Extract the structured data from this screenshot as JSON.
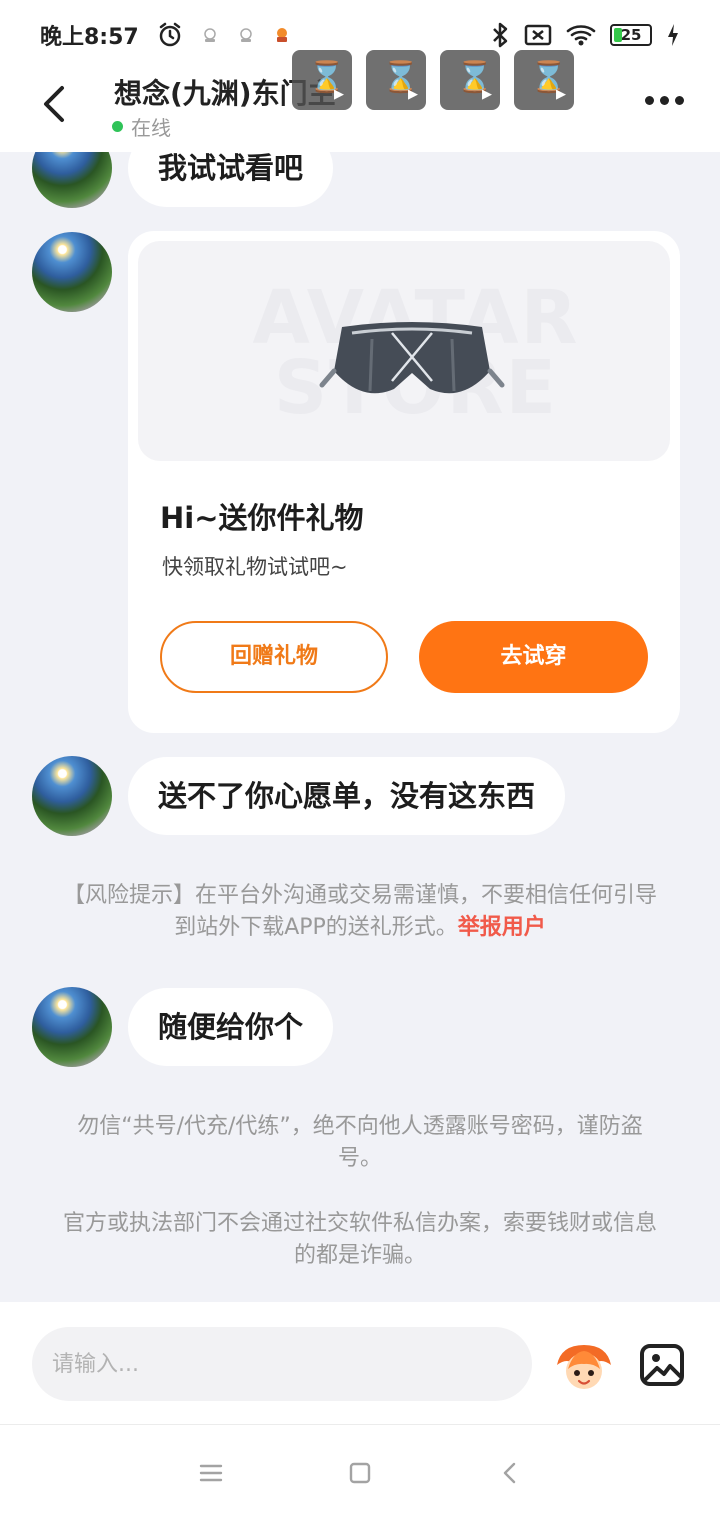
{
  "status_bar": {
    "time": "晚上8:57",
    "battery": "25"
  },
  "header": {
    "title": "想念(九渊)东门主",
    "status": "在线"
  },
  "messages": [
    {
      "text": "我试试看吧"
    },
    {
      "text": "送不了你心愿单，没有这东西"
    },
    {
      "text": "随便给你个"
    }
  ],
  "gift_card": {
    "watermark_line1": "AVATAR",
    "watermark_line2": "STORE",
    "title": "Hi~送你件礼物",
    "subtitle": "快领取礼物试试吧~",
    "return_label": "回赠礼物",
    "try_label": "去试穿"
  },
  "notices": {
    "risk": "【风险提示】在平台外沟通或交易需谨慎，不要相信任何引导到站外下载APP的送礼形式。",
    "report_link": "举报用户",
    "account_warning": "勿信“共号/代充/代练”，绝不向他人透露账号密码，谨防盗号。",
    "fraud_warning": "官方或执法部门不会通过社交软件私信办案，索要钱财或信息的都是诈骗。"
  },
  "input": {
    "placeholder": "请输入..."
  },
  "colors": {
    "accent": "#ff7413",
    "link": "#f15a4a",
    "online": "#2fc358"
  }
}
